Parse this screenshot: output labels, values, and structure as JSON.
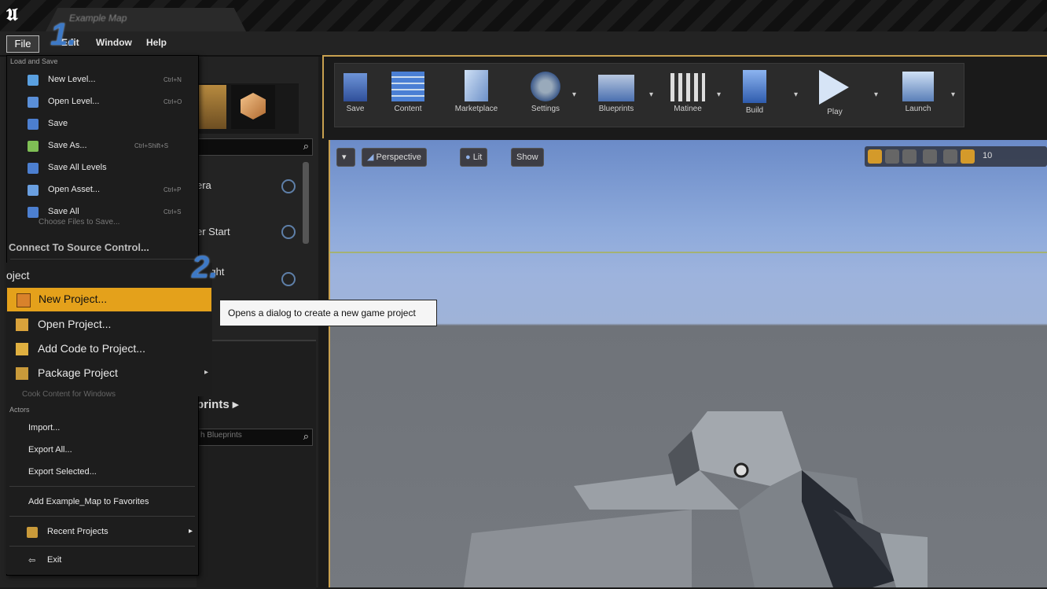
{
  "tab": {
    "title": "Example Map"
  },
  "menubar": {
    "file": "File",
    "edit": "Edit",
    "window": "Window",
    "help": "Help"
  },
  "annotations": {
    "step1": "1.",
    "step2": "2."
  },
  "file_menu": {
    "load_save_header": "Load and Save",
    "items": [
      {
        "label": "New Level...",
        "shortcut": "Ctrl+N",
        "icon": "new-level-icon",
        "color": "#5aa0e0"
      },
      {
        "label": "Open Level...",
        "shortcut": "Ctrl+O",
        "icon": "open-level-icon",
        "color": "#5a8fd8"
      },
      {
        "label": "Save",
        "shortcut": "",
        "icon": "save-icon",
        "color": "#4c7fd0"
      },
      {
        "label": "Save As...",
        "shortcut": "Ctrl+Shift+S",
        "icon": "save-as-icon",
        "color": "#7fbf55"
      },
      {
        "label": "Save All Levels",
        "shortcut": "",
        "icon": "save-all-levels-icon",
        "color": "#4c7fd0"
      },
      {
        "label": "Open Asset...",
        "shortcut": "Ctrl+P",
        "icon": "open-asset-icon",
        "color": "#6a9fe0"
      },
      {
        "label": "Save All",
        "shortcut": "Ctrl+S",
        "icon": "save-all-icon",
        "color": "#4c7fd0"
      }
    ],
    "choose_files": "Choose Files to Save...",
    "connect_source_control": "Connect To Source Control...",
    "project_header": "oject",
    "project_items": [
      {
        "label": "New Project...",
        "icon": "new-project-icon",
        "color": "#d9822b"
      },
      {
        "label": "Open Project...",
        "icon": "open-project-icon",
        "color": "#d9a23b"
      },
      {
        "label": "Add Code to Project...",
        "icon": "add-code-icon",
        "color": "#e0b040"
      },
      {
        "label": "Package Project",
        "icon": "package-project-icon",
        "color": "#c99a3a"
      }
    ],
    "cook_content": "Cook Content for Windows",
    "actors_header": "Actors",
    "actor_items": [
      "Import...",
      "Export All...",
      "Export Selected..."
    ],
    "favorites": "Add Example_Map to Favorites",
    "recent_projects": "Recent Projects",
    "exit": "Exit"
  },
  "tooltip": "Opens a dialog to create a new game project",
  "left_panel": {
    "place_items": [
      "era",
      "er Start",
      "t Light"
    ],
    "blueprints_label": "prints ▸",
    "blueprint_search_placeholder": "h Blueprints"
  },
  "toolbar": {
    "buttons": [
      {
        "label": "Save",
        "icon": "save-icon"
      },
      {
        "label": "Content",
        "icon": "content-browser-icon"
      },
      {
        "label": "Marketplace",
        "icon": "marketplace-icon"
      },
      {
        "label": "Settings",
        "icon": "settings-icon"
      },
      {
        "label": "Blueprints",
        "icon": "blueprints-icon"
      },
      {
        "label": "Matinee",
        "icon": "matinee-icon"
      },
      {
        "label": "Build",
        "icon": "build-icon"
      },
      {
        "label": "Play",
        "icon": "play-icon"
      },
      {
        "label": "Launch",
        "icon": "launch-icon"
      }
    ]
  },
  "viewport": {
    "menu_button": "▾",
    "perspective": "Perspective",
    "lit": "Lit",
    "show": "Show",
    "grid_value": "10"
  },
  "colors": {
    "accent": "#e4a11b",
    "step_blue": "#3d79c6",
    "sky": "#8eaadb",
    "ground": "#75797f"
  }
}
